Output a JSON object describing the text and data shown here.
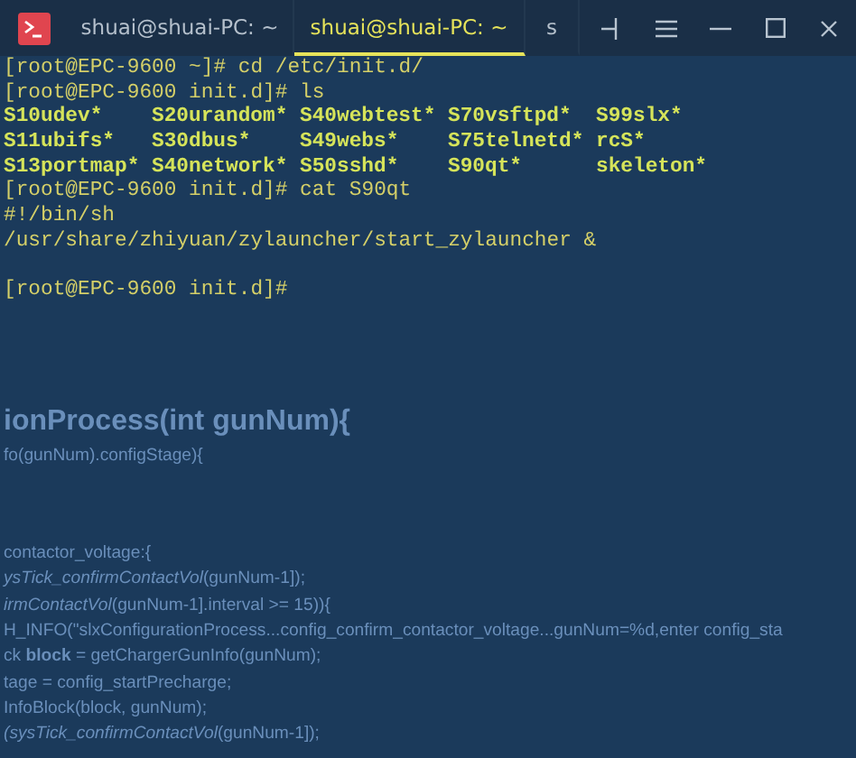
{
  "tabs": [
    {
      "label": "shuai@shuai-PC: ~",
      "selected": false
    },
    {
      "label": "shuai@shuai-PC: ~",
      "selected": true
    },
    {
      "label": "s",
      "selected": false
    }
  ],
  "terminal_lines": [
    {
      "kind": "plain",
      "text": "[root@EPC-9600 ~]# cd /etc/init.d/"
    },
    {
      "kind": "plain",
      "text": "[root@EPC-9600 init.d]# ls"
    },
    {
      "kind": "listing",
      "cells": [
        "S10udev*",
        "S20urandom*",
        "S40webtest*",
        "S70vsftpd*",
        "S99slx*"
      ]
    },
    {
      "kind": "listing",
      "cells": [
        "S11ubifs*",
        "S30dbus*",
        "S49webs*",
        "S75telnetd*",
        "rcS*"
      ]
    },
    {
      "kind": "listing",
      "cells": [
        "S13portmap*",
        "S40network*",
        "S50sshd*",
        "S90qt*",
        "skeleton*"
      ]
    },
    {
      "kind": "plain",
      "text": "[root@EPC-9600 init.d]# cat S90qt"
    },
    {
      "kind": "plain",
      "text": "#!/bin/sh"
    },
    {
      "kind": "plain",
      "text": "/usr/share/zhiyuan/zylauncher/start_zylauncher &"
    },
    {
      "kind": "blank"
    },
    {
      "kind": "plain",
      "text": "[root@EPC-9600 init.d]#"
    }
  ],
  "background_code": [
    {
      "kind": "heading",
      "text": "ionProcess(int gunNum){"
    },
    {
      "kind": "line",
      "text": "fo(gunNum).configStage){"
    },
    {
      "kind": "spaced",
      "text": "contactor_voltage:{"
    },
    {
      "kind": "line",
      "text": "*ysTick_confirmContactVol*(gunNum-1]);"
    },
    {
      "kind": "line",
      "text": "*irmContactVol*(gunNum-1].interval >= 15)){"
    },
    {
      "kind": "line",
      "text": "H_INFO(\"slxConfigurationProcess...config_confirm_contactor_voltage...gunNum=%d,enter config_sta"
    },
    {
      "kind": "line",
      "text": "ck **block** = getChargerGunInfo(gunNum);"
    },
    {
      "kind": "line",
      "text": "tage = config_startPrecharge;"
    },
    {
      "kind": "line",
      "text": "InfoBlock(block, gunNum);"
    },
    {
      "kind": "line",
      "text": "*(sysTick_confirmContactVol*(gunNum-1]);"
    }
  ]
}
